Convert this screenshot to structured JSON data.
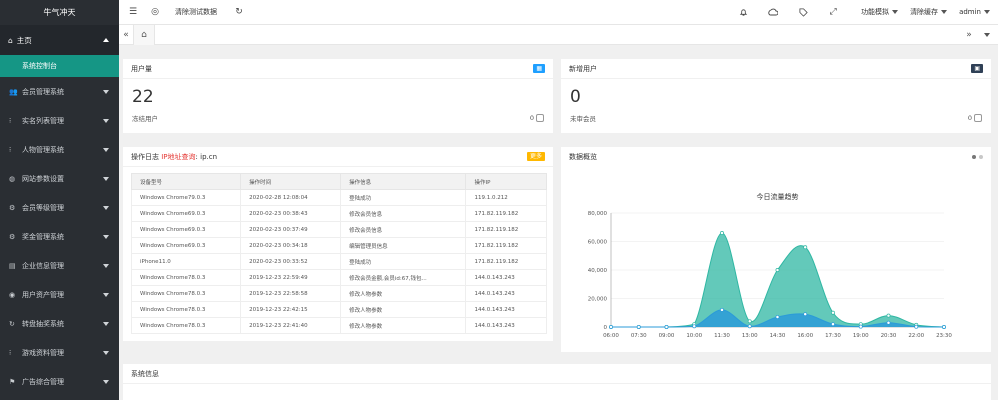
{
  "sidebar": {
    "brand": "牛气冲天",
    "top": "主页",
    "active": "系统控制台",
    "items": [
      {
        "label": "会员管理系统",
        "icon": "users-icon"
      },
      {
        "label": "实名列表管理",
        "icon": "dots-icon"
      },
      {
        "label": "人物管理系统",
        "icon": "dots-icon"
      },
      {
        "label": "网站参数设置",
        "icon": "globe-icon"
      },
      {
        "label": "会员等级管理",
        "icon": "gear-icon"
      },
      {
        "label": "奖金管理系统",
        "icon": "settings-icon"
      },
      {
        "label": "企业信息管理",
        "icon": "folder-icon"
      },
      {
        "label": "用户资产管理",
        "icon": "user-icon"
      },
      {
        "label": "转盘抽奖系统",
        "icon": "refresh-icon"
      },
      {
        "label": "游戏资料管理",
        "icon": "dots-icon"
      },
      {
        "label": "广告综合管理",
        "icon": "flag-icon"
      }
    ]
  },
  "header": {
    "clear_test_data": "清除测试数据",
    "menu_mock": "功能模拟",
    "menu_clear_cache": "清除缓存",
    "user": "admin"
  },
  "cards": {
    "users": {
      "title": "用户量",
      "value": "22",
      "sub": "冻结用户",
      "sub_value": "0",
      "badge_color": "#1e9fff"
    },
    "new_users": {
      "title": "新增用户",
      "value": "0",
      "sub": "未审会员",
      "sub_value": "0",
      "badge_color": "#2f4056"
    },
    "log": {
      "title_prefix": "操作日志",
      "title_link": "IP地址查询",
      "title_suffix": "ip.cn",
      "badge": "更多",
      "badge_color": "#ffb800",
      "columns": [
        "设备型号",
        "操作时间",
        "操作信息",
        "操作IP"
      ],
      "rows": [
        [
          "Windows Chrome79.0.3",
          "2020-02-28 12:08:04",
          "登陆成功",
          "119.1.0.212"
        ],
        [
          "Windows Chrome69.0.3",
          "2020-02-23 00:38:43",
          "修改会员信息",
          "171.82.119.182"
        ],
        [
          "Windows Chrome69.0.3",
          "2020-02-23 00:37:49",
          "修改会员信息",
          "171.82.119.182"
        ],
        [
          "Windows Chrome69.0.3",
          "2020-02-23 00:34:18",
          "编辑管理员信息",
          "171.82.119.182"
        ],
        [
          "iPhone11.0",
          "2020-02-23 00:33:52",
          "登陆成功",
          "171.82.119.182"
        ],
        [
          "Windows Chrome78.0.3",
          "2019-12-23 22:59:49",
          "修改会员金额,会员id:67,钱包...",
          "144.0.143.243"
        ],
        [
          "Windows Chrome78.0.3",
          "2019-12-23 22:58:58",
          "修改人物参数",
          "144.0.143.243"
        ],
        [
          "Windows Chrome78.0.3",
          "2019-12-23 22:42:15",
          "修改人物参数",
          "144.0.143.243"
        ],
        [
          "Windows Chrome78.0.3",
          "2019-12-23 22:41:40",
          "修改人物参数",
          "144.0.143.243"
        ]
      ]
    },
    "data_overview": {
      "title": "数据概览"
    },
    "sysinfo": {
      "title": "系统信息"
    }
  },
  "chart_data": {
    "type": "area",
    "title": "今日流量趋势",
    "x": [
      "06:00",
      "07:30",
      "09:00",
      "10:00",
      "11:30",
      "13:00",
      "14:30",
      "16:00",
      "17:30",
      "19:00",
      "20:30",
      "22:00",
      "23:30"
    ],
    "ylim": [
      0,
      80000
    ],
    "yticks": [
      "0",
      "20,000",
      "40,000",
      "60,000",
      "80,000"
    ],
    "series": [
      {
        "values": [
          0,
          0,
          0,
          2000,
          66000,
          4000,
          40000,
          56000,
          10000,
          2000,
          8000,
          1500,
          0
        ],
        "color": "#2fb7a3"
      },
      {
        "values": [
          0,
          0,
          0,
          500,
          12000,
          500,
          7000,
          9000,
          2000,
          300,
          3000,
          200,
          0
        ],
        "color": "#2b9bd8"
      }
    ]
  }
}
